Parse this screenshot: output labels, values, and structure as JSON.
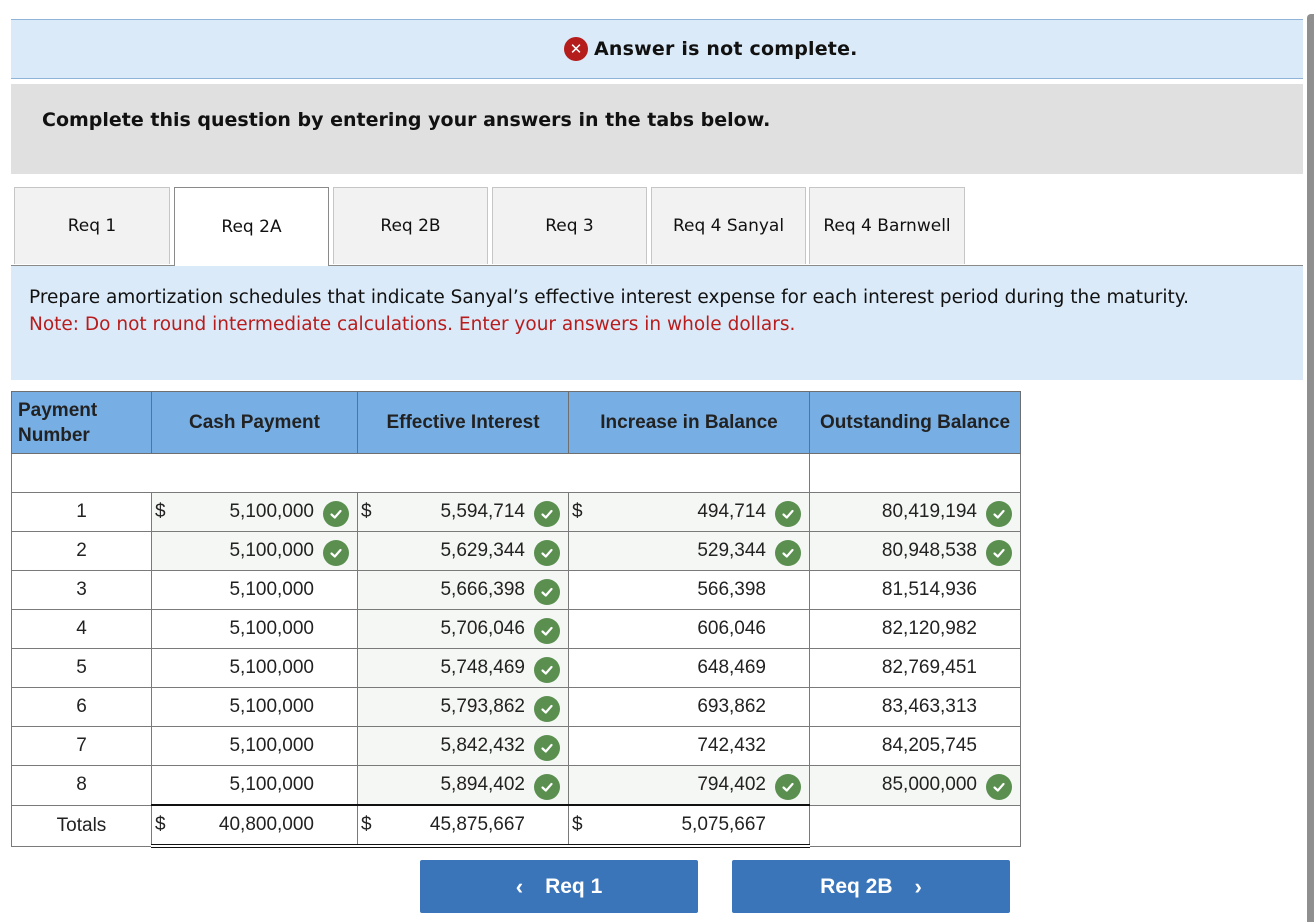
{
  "banner": {
    "icon": "error-x-icon",
    "text": "Answer is not complete."
  },
  "instruction": "Complete this question by entering your answers in the tabs below.",
  "tabs": [
    {
      "label": "Req 1",
      "active": false
    },
    {
      "label": "Req 2A",
      "active": true
    },
    {
      "label": "Req 2B",
      "active": false
    },
    {
      "label": "Req 3",
      "active": false
    },
    {
      "label": "Req 4 Sanyal",
      "active": false
    },
    {
      "label": "Req 4 Barnwell",
      "active": false
    }
  ],
  "prompt": {
    "text": "Prepare amortization schedules that indicate Sanyal’s effective interest expense for each interest period during the maturity.",
    "note": "Note: Do not round intermediate calculations. Enter your answers in whole dollars."
  },
  "table": {
    "headers": {
      "payment_number": "Payment Number",
      "cash_payment": "Cash Payment",
      "effective_interest": "Effective Interest",
      "increase_in_balance": "Increase in Balance",
      "outstanding_balance": "Outstanding Balance"
    },
    "currency_symbol": "$",
    "rows": [
      {
        "n": "1",
        "cash": "5,100,000",
        "cash_ok": true,
        "eff": "5,594,714",
        "eff_ok": true,
        "inc": "494,714",
        "inc_ok": true,
        "out": "80,419,194",
        "out_ok": true,
        "dollar": true
      },
      {
        "n": "2",
        "cash": "5,100,000",
        "cash_ok": true,
        "eff": "5,629,344",
        "eff_ok": true,
        "inc": "529,344",
        "inc_ok": true,
        "out": "80,948,538",
        "out_ok": true,
        "dollar": false
      },
      {
        "n": "3",
        "cash": "5,100,000",
        "cash_ok": false,
        "eff": "5,666,398",
        "eff_ok": true,
        "inc": "566,398",
        "inc_ok": false,
        "out": "81,514,936",
        "out_ok": false,
        "dollar": false
      },
      {
        "n": "4",
        "cash": "5,100,000",
        "cash_ok": false,
        "eff": "5,706,046",
        "eff_ok": true,
        "inc": "606,046",
        "inc_ok": false,
        "out": "82,120,982",
        "out_ok": false,
        "dollar": false
      },
      {
        "n": "5",
        "cash": "5,100,000",
        "cash_ok": false,
        "eff": "5,748,469",
        "eff_ok": true,
        "inc": "648,469",
        "inc_ok": false,
        "out": "82,769,451",
        "out_ok": false,
        "dollar": false
      },
      {
        "n": "6",
        "cash": "5,100,000",
        "cash_ok": false,
        "eff": "5,793,862",
        "eff_ok": true,
        "inc": "693,862",
        "inc_ok": false,
        "out": "83,463,313",
        "out_ok": false,
        "dollar": false
      },
      {
        "n": "7",
        "cash": "5,100,000",
        "cash_ok": false,
        "eff": "5,842,432",
        "eff_ok": true,
        "inc": "742,432",
        "inc_ok": false,
        "out": "84,205,745",
        "out_ok": false,
        "dollar": false
      },
      {
        "n": "8",
        "cash": "5,100,000",
        "cash_ok": false,
        "eff": "5,894,402",
        "eff_ok": true,
        "inc": "794,402",
        "inc_ok": true,
        "out": "85,000,000",
        "out_ok": true,
        "dollar": false
      }
    ],
    "totals": {
      "label": "Totals",
      "cash": "40,800,000",
      "eff": "45,875,667",
      "inc": "5,075,667"
    }
  },
  "nav": {
    "prev_label": "Req 1",
    "prev_icon": "chevron-left-icon",
    "next_label": "Req 2B",
    "next_icon": "chevron-right-icon"
  },
  "colors": {
    "banner_bg": "#dbeaf8",
    "error_red": "#b51c1c",
    "note_red": "#b81c1c",
    "header_blue": "#77aee4",
    "check_green": "#5a8f50",
    "button_blue": "#3a75ba"
  }
}
